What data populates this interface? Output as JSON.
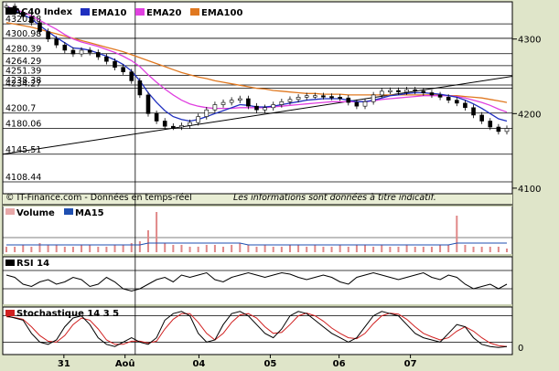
{
  "chart_data": {
    "type": "line",
    "instrument": "CAC40 Index",
    "legend": [
      {
        "name": "EMA10",
        "color": "#1f2fbf"
      },
      {
        "name": "EMA20",
        "color": "#e040e0"
      },
      {
        "name": "EMA100",
        "color": "#e07820"
      }
    ],
    "price_levels": [
      "4320.38",
      "4300.98",
      "4280.39",
      "4264.29",
      "4251.39",
      "4238.38",
      "4234.27",
      "4200.7",
      "4180.06",
      "4145.51",
      "4108.44"
    ],
    "price_level_values": [
      4320.38,
      4300.98,
      4280.39,
      4264.29,
      4251.39,
      4238.38,
      4234.27,
      4200.7,
      4180.06,
      4145.51,
      4108.44
    ],
    "right_axis": [
      "4300",
      "4200",
      "4100"
    ],
    "right_axis_values": [
      4300,
      4200,
      4100
    ],
    "ylim": [
      4095,
      4345
    ],
    "x_ticks": [
      "31",
      "Aoû",
      "04",
      "05",
      "06",
      "07"
    ],
    "x_tick_positions": [
      0.12,
      0.24,
      0.385,
      0.525,
      0.66,
      0.8
    ],
    "credit": "© IT-Finance.com - Données en temps-réel",
    "disclaimer": "Les informations sont données à titre indicatif.",
    "close": [
      4344,
      4336,
      4330,
      4322,
      4310,
      4300,
      4292,
      4285,
      4280,
      4285,
      4282,
      4276,
      4270,
      4262,
      4256,
      4244,
      4225,
      4200,
      4190,
      4183,
      4182,
      4184,
      4188,
      4196,
      4205,
      4212,
      4215,
      4218,
      4220,
      4210,
      4205,
      4208,
      4212,
      4216,
      4219,
      4222,
      4224,
      4224,
      4223,
      4222,
      4221,
      4215,
      4210,
      4216,
      4225,
      4230,
      4231,
      4229,
      4232,
      4230,
      4228,
      4225,
      4222,
      4218,
      4214,
      4208,
      4198,
      4190,
      4182,
      4176,
      4180
    ],
    "ema10": [
      4344,
      4338,
      4333,
      4327,
      4318,
      4310,
      4302,
      4295,
      4288,
      4287,
      4285,
      4281,
      4277,
      4272,
      4266,
      4257,
      4244,
      4228,
      4215,
      4204,
      4196,
      4192,
      4190,
      4192,
      4196,
      4200,
      4204,
      4208,
      4212,
      4211,
      4209,
      4209,
      4210,
      4212,
      4214,
      4216,
      4218,
      4219,
      4220,
      4220,
      4220,
      4218,
      4216,
      4216,
      4218,
      4221,
      4224,
      4225,
      4227,
      4228,
      4228,
      4227,
      4226,
      4224,
      4222,
      4218,
      4213,
      4207,
      4200,
      4193,
      4190
    ],
    "ema20": [
      4344,
      4340,
      4336,
      4331,
      4325,
      4319,
      4313,
      4306,
      4300,
      4296,
      4293,
      4290,
      4286,
      4282,
      4277,
      4271,
      4263,
      4252,
      4242,
      4233,
      4225,
      4218,
      4213,
      4210,
      4208,
      4207,
      4207,
      4207,
      4208,
      4208,
      4208,
      4208,
      4209,
      4210,
      4211,
      4212,
      4213,
      4214,
      4215,
      4216,
      4216,
      4216,
      4216,
      4216,
      4217,
      4219,
      4220,
      4221,
      4222,
      4223,
      4224,
      4224,
      4224,
      4224,
      4223,
      4221,
      4218,
      4215,
      4211,
      4206,
      4202
    ],
    "ema100": [
      4322,
      4320,
      4318,
      4316,
      4313,
      4310,
      4307,
      4304,
      4301,
      4298,
      4295,
      4292,
      4289,
      4286,
      4283,
      4279,
      4275,
      4271,
      4267,
      4263,
      4259,
      4255,
      4252,
      4249,
      4247,
      4244,
      4242,
      4240,
      4238,
      4236,
      4234,
      4233,
      4231,
      4230,
      4229,
      4228,
      4227,
      4227,
      4226,
      4226,
      4226,
      4225,
      4225,
      4225,
      4225,
      4225,
      4225,
      4225,
      4225,
      4225,
      4225,
      4225,
      4225,
      4224,
      4224,
      4223,
      4222,
      4221,
      4219,
      4217,
      4215
    ],
    "trendline": {
      "from": 4145.51,
      "to": 4250
    },
    "vertical_marker_x": 0.26,
    "volume_panel": {
      "legend": [
        {
          "name": "Volume",
          "color": "#e8a8a8"
        },
        {
          "name": "MA15",
          "color": "#1f4fb0"
        }
      ],
      "volume": [
        3,
        3,
        4,
        3,
        5,
        4,
        4,
        3,
        3,
        4,
        4,
        3,
        3,
        4,
        4,
        5,
        6,
        12,
        22,
        5,
        4,
        4,
        3,
        3,
        4,
        4,
        3,
        4,
        5,
        4,
        3,
        4,
        3,
        3,
        4,
        4,
        3,
        4,
        3,
        3,
        4,
        3,
        4,
        4,
        3,
        4,
        3,
        3,
        4,
        3,
        3,
        3,
        4,
        4,
        20,
        4,
        3,
        3,
        3,
        3,
        2
      ],
      "ma15": [
        4,
        4,
        4,
        4,
        4,
        4,
        4,
        4,
        4,
        4,
        4,
        4,
        4,
        4,
        4,
        4,
        4,
        5,
        5,
        5,
        5,
        5,
        5,
        5,
        5,
        5,
        5,
        5,
        5,
        4,
        4,
        4,
        4,
        4,
        4,
        4,
        4,
        4,
        4,
        4,
        4,
        4,
        4,
        4,
        4,
        4,
        4,
        4,
        4,
        4,
        4,
        4,
        4,
        4,
        5,
        5,
        5,
        5,
        5,
        5,
        5
      ]
    },
    "rsi_panel": {
      "name": "RSI 14",
      "values": [
        60,
        55,
        40,
        35,
        45,
        50,
        40,
        45,
        55,
        50,
        35,
        40,
        55,
        45,
        30,
        25,
        30,
        40,
        50,
        55,
        45,
        60,
        55,
        60,
        65,
        50,
        45,
        55,
        60,
        65,
        60,
        55,
        60,
        65,
        62,
        55,
        50,
        55,
        60,
        55,
        45,
        40,
        55,
        60,
        65,
        60,
        55,
        50,
        55,
        60,
        65,
        55,
        50,
        60,
        55,
        40,
        30,
        35,
        40,
        30,
        40
      ],
      "levels": [
        30,
        70
      ]
    },
    "stoch_panel": {
      "name": "Stochastique 14 3 5",
      "k": [
        80,
        75,
        70,
        40,
        20,
        15,
        25,
        55,
        75,
        80,
        60,
        30,
        15,
        10,
        20,
        30,
        20,
        15,
        30,
        70,
        85,
        90,
        80,
        40,
        20,
        25,
        60,
        85,
        90,
        80,
        60,
        40,
        30,
        50,
        80,
        90,
        85,
        70,
        55,
        40,
        30,
        20,
        30,
        55,
        80,
        90,
        85,
        80,
        60,
        40,
        30,
        25,
        20,
        40,
        60,
        55,
        30,
        15,
        10,
        8,
        10
      ],
      "d": [
        78,
        76,
        72,
        55,
        35,
        22,
        20,
        35,
        60,
        75,
        70,
        50,
        25,
        15,
        15,
        22,
        22,
        18,
        22,
        50,
        72,
        85,
        85,
        65,
        40,
        25,
        40,
        65,
        82,
        85,
        75,
        55,
        40,
        42,
        60,
        80,
        86,
        80,
        68,
        52,
        40,
        30,
        28,
        40,
        62,
        80,
        86,
        84,
        72,
        55,
        40,
        32,
        25,
        30,
        45,
        55,
        45,
        30,
        18,
        12,
        10
      ],
      "axis_label": "0",
      "levels": [
        20,
        80
      ]
    }
  }
}
